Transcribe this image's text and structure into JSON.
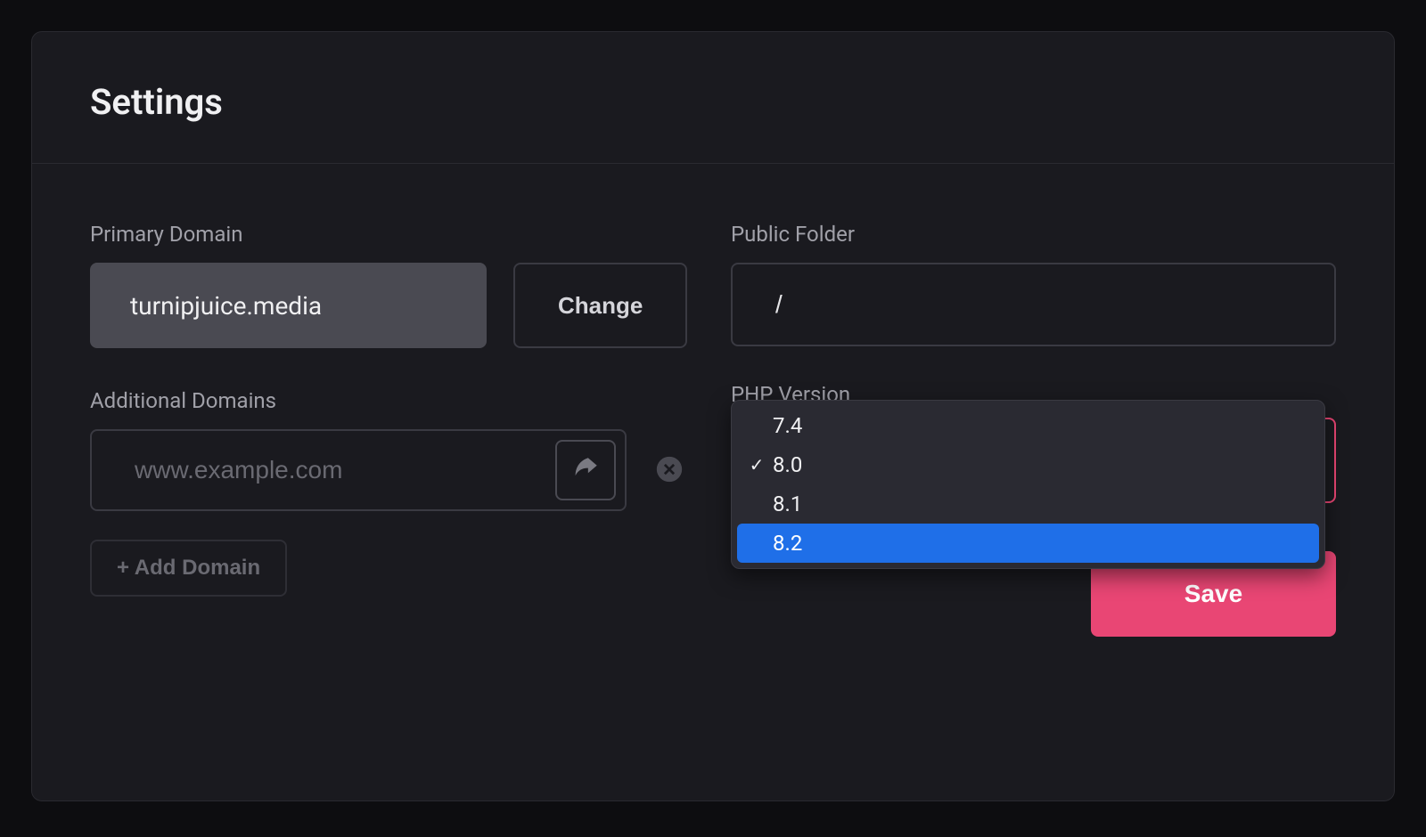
{
  "header": {
    "title": "Settings"
  },
  "left": {
    "primary_domain_label": "Primary Domain",
    "primary_domain_value": "turnipjuice.media",
    "change_label": "Change",
    "additional_domains_label": "Additional Domains",
    "domain_placeholder": "www.example.com",
    "add_domain_label": "+ Add Domain"
  },
  "right": {
    "public_folder_label": "Public Folder",
    "public_folder_value": "/",
    "php_version_label": "PHP Version",
    "php_options": [
      {
        "value": "7.4",
        "selected": false,
        "highlighted": false
      },
      {
        "value": "8.0",
        "selected": true,
        "highlighted": false
      },
      {
        "value": "8.1",
        "selected": false,
        "highlighted": false
      },
      {
        "value": "8.2",
        "selected": false,
        "highlighted": true
      }
    ]
  },
  "actions": {
    "save_label": "Save"
  }
}
